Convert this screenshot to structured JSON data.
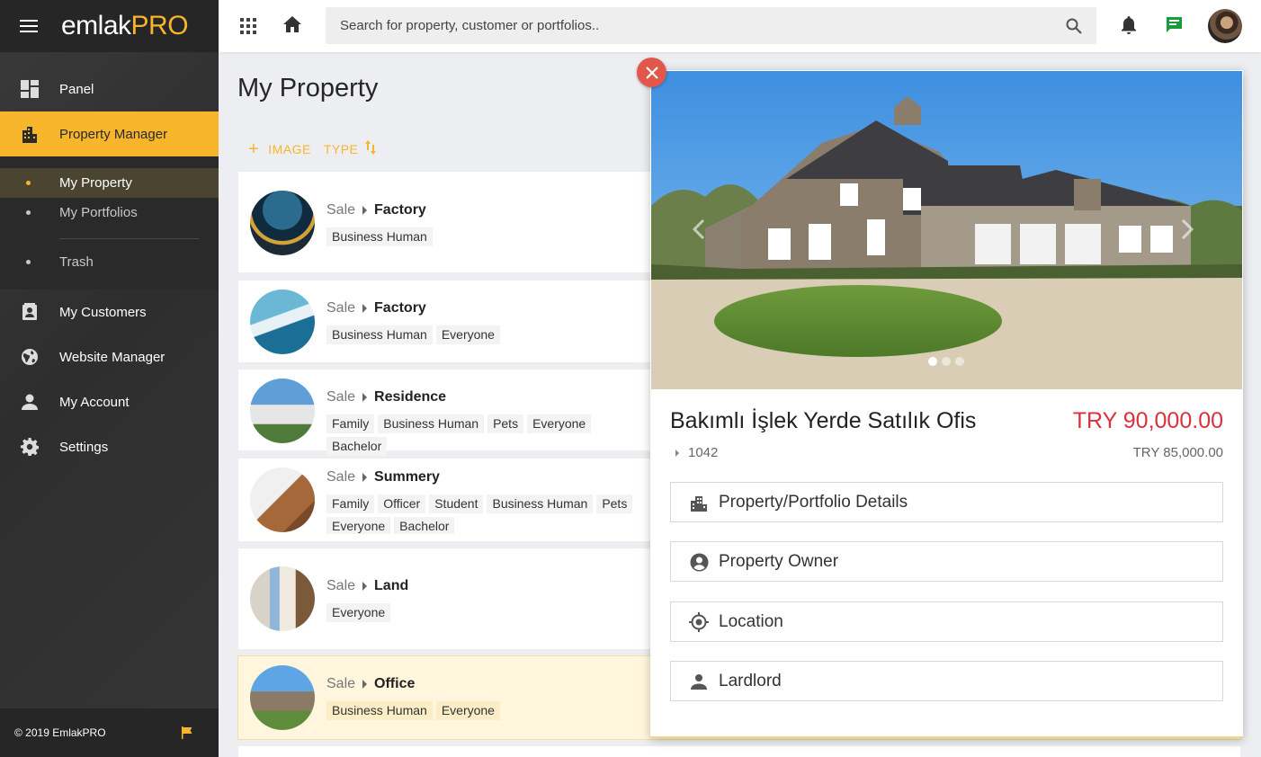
{
  "app": {
    "logo_part1": "emlak",
    "logo_part2": "PRO"
  },
  "sidebar": {
    "items": [
      {
        "label": "Panel",
        "icon": "dashboard-icon"
      },
      {
        "label": "Property Manager",
        "icon": "building-icon",
        "active": true
      },
      {
        "label": "My Customers",
        "icon": "contacts-icon"
      },
      {
        "label": "Website Manager",
        "icon": "globe-icon"
      },
      {
        "label": "My Account",
        "icon": "person-icon"
      },
      {
        "label": "Settings",
        "icon": "gear-icon"
      }
    ],
    "sub_items": [
      {
        "label": "My Property",
        "active": true
      },
      {
        "label": "My Portfolios"
      },
      {
        "label": "Trash"
      }
    ],
    "footer": "© 2019 EmlakPRO"
  },
  "topbar": {
    "search_placeholder": "Search for property, customer or portfolios.."
  },
  "main": {
    "title": "My Property",
    "actions": {
      "image": "IMAGE",
      "type": "TYPE"
    },
    "cards": [
      {
        "sale": "Sale",
        "kind": "Factory",
        "tags": [
          "Business Human"
        ]
      },
      {
        "sale": "Sale",
        "kind": "Factory",
        "tags": [
          "Business Human",
          "Everyone"
        ]
      },
      {
        "sale": "Sale",
        "kind": "Residence",
        "tags": [
          "Family",
          "Business Human",
          "Pets",
          "Everyone",
          "Bachelor"
        ]
      },
      {
        "sale": "Sale",
        "kind": "Summery",
        "tags": [
          "Family",
          "Officer",
          "Student",
          "Business Human",
          "Pets",
          "Everyone",
          "Bachelor"
        ]
      },
      {
        "sale": "Sale",
        "kind": "Land",
        "tags": [
          "Everyone"
        ]
      },
      {
        "sale": "Sale",
        "kind": "Office",
        "tags": [
          "Business Human",
          "Everyone"
        ],
        "highlighted": true
      }
    ]
  },
  "detail": {
    "title": "Bakımlı İşlek Yerde Satılık Ofis",
    "price": "TRY 90,000.00",
    "old_price": "TRY 85,000.00",
    "ref": "1042",
    "carousel_slides": 3,
    "carousel_active": 0,
    "sections": [
      {
        "label": "Property/Portfolio Details",
        "icon": "building-icon"
      },
      {
        "label": "Property Owner",
        "icon": "account-circle-icon"
      },
      {
        "label": "Location",
        "icon": "location-target-icon"
      },
      {
        "label": "Lardlord",
        "icon": "person-icon"
      }
    ]
  },
  "colors": {
    "accent": "#f7b52c",
    "price": "#d9313f",
    "sidebar_bg": "#333333",
    "close": "#e2574c"
  }
}
